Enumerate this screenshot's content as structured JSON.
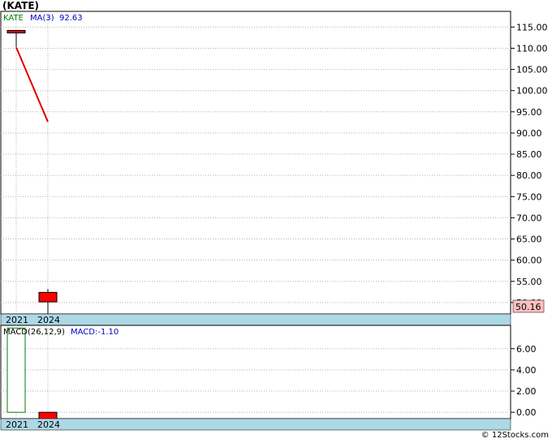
{
  "page": {
    "ticker_title": "(KATE)",
    "credit": "© 12Stocks.com"
  },
  "chart_data": [
    {
      "type": "candlestick",
      "legend": {
        "ticker": "KATE",
        "ma_label": "MA(3)",
        "ma_value": "92.63"
      },
      "x_tick_labels": [
        "2021",
        "2024"
      ],
      "y_tick_labels": [
        "115.00",
        "110.00",
        "105.00",
        "100.00",
        "95.00",
        "90.00",
        "85.00",
        "80.00",
        "75.00",
        "70.00",
        "65.00",
        "60.00",
        "55.00",
        "50.00"
      ],
      "yticks": [
        115,
        110,
        105,
        100,
        95,
        90,
        85,
        80,
        75,
        70,
        65,
        60,
        55,
        50
      ],
      "ylim": [
        47.3,
        118.7
      ],
      "candles": [
        {
          "x": "2021",
          "open": 114.2,
          "close": 113.6,
          "high": 114.3,
          "low": 110.3
        },
        {
          "x": "2024",
          "open": 52.4,
          "close": 50.16,
          "high": 53.2,
          "low": 47.3
        }
      ],
      "ma": {
        "name": "MA(3)",
        "points": [
          {
            "x": "2021",
            "y": 110.2
          },
          {
            "x": "2024",
            "y": 92.63
          }
        ]
      },
      "last_price_label": "50.16",
      "colors": {
        "up": "#ffffff",
        "down": "#ff0000",
        "ma": "#e00000",
        "axis_band": "#add8e6",
        "price_tag": "#ffc0c0"
      }
    },
    {
      "type": "bar",
      "legend": {
        "name": "MACD(26,12,9)",
        "value_label": "MACD:-1.10"
      },
      "x_tick_labels": [
        "2021",
        "2024"
      ],
      "y_tick_labels": [
        "6.00",
        "4.00",
        "2.00",
        "0.00"
      ],
      "yticks": [
        6,
        4,
        2,
        0
      ],
      "ylim": [
        -0.6,
        8.2
      ],
      "bars": [
        {
          "x": "2021",
          "base": 0,
          "top": 7.95,
          "style": "hollow-green"
        },
        {
          "x": "2024",
          "base": 0,
          "top": -1.1,
          "style": "filled-red"
        }
      ]
    }
  ]
}
